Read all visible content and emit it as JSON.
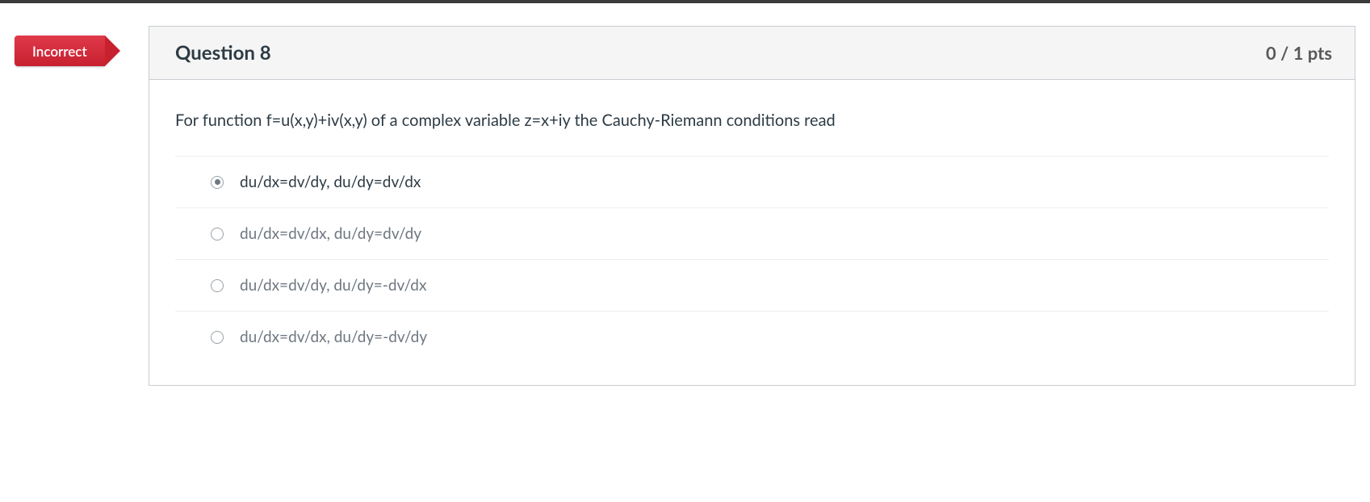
{
  "status_flag": "Incorrect",
  "question": {
    "title": "Question 8",
    "points": "0 / 1 pts",
    "prompt": "For function f=u(x,y)+iv(x,y) of a complex variable z=x+iy the Cauchy-Riemann conditions read"
  },
  "answers": [
    {
      "text": "du/dx=dv/dy, du/dy=dv/dx",
      "selected": true
    },
    {
      "text": "du/dx=dv/dx, du/dy=dv/dy",
      "selected": false
    },
    {
      "text": "du/dx=dv/dy, du/dy=-dv/dx",
      "selected": false
    },
    {
      "text": "du/dx=dv/dx, du/dy=-dv/dy",
      "selected": false
    }
  ]
}
